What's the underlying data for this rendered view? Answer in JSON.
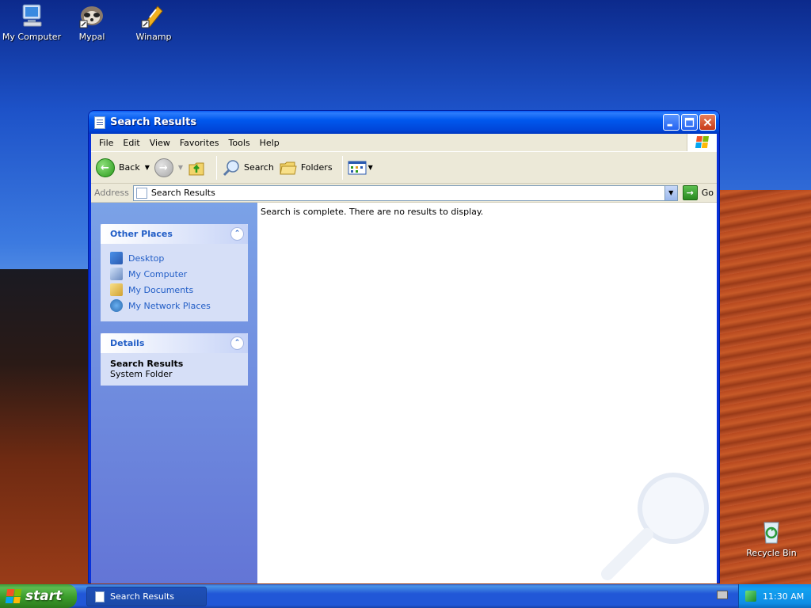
{
  "desktop": {
    "icons": [
      {
        "label": "My Computer"
      },
      {
        "label": "Mypal"
      },
      {
        "label": "Winamp"
      },
      {
        "label": "Recycle Bin"
      }
    ]
  },
  "window": {
    "title": "Search Results",
    "menu": [
      "File",
      "Edit",
      "View",
      "Favorites",
      "Tools",
      "Help"
    ],
    "toolbar": {
      "back": "Back",
      "search": "Search",
      "folders": "Folders"
    },
    "address": {
      "label": "Address",
      "value": "Search Results",
      "go": "Go"
    },
    "sidebar": {
      "other_places": {
        "title": "Other Places",
        "items": [
          "Desktop",
          "My Computer",
          "My Documents",
          "My Network Places"
        ]
      },
      "details": {
        "title": "Details",
        "name": "Search Results",
        "type": "System Folder"
      }
    },
    "content": {
      "message": "Search is complete. There are no results to display."
    }
  },
  "taskbar": {
    "start": "start",
    "task": "Search Results",
    "clock": "11:30 AM"
  },
  "colors": {
    "title_blue": "#0058ee",
    "link_blue": "#215dc6",
    "start_green": "#3a9c2a",
    "tray_blue": "#0f8de4"
  }
}
